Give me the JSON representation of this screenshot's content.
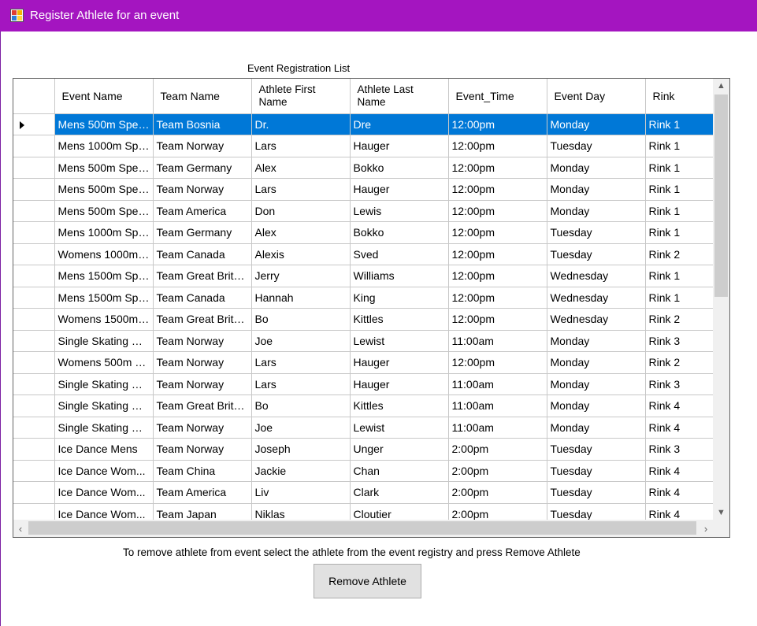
{
  "window": {
    "title": "Register Athlete for an event",
    "icon": "app-grid-icon"
  },
  "grid": {
    "caption": "Event Registration List",
    "columns": [
      "Event Name",
      "Team Name",
      "Athlete First Name",
      "Athlete Last Name",
      "Event_Time",
      "Event Day",
      "Rink"
    ],
    "selected_row": 0,
    "rows": [
      [
        "Mens 500m Spee...",
        "Team Bosnia",
        "Dr.",
        "Dre",
        "12:00pm",
        "Monday",
        "Rink 1"
      ],
      [
        "Mens 1000m Spe...",
        "Team Norway",
        "Lars",
        "Hauger",
        "12:00pm",
        "Tuesday",
        "Rink 1"
      ],
      [
        "Mens 500m Spee...",
        "Team Germany",
        "Alex",
        "Bokko",
        "12:00pm",
        "Monday",
        "Rink 1"
      ],
      [
        "Mens 500m Spee...",
        "Team Norway",
        "Lars",
        "Hauger",
        "12:00pm",
        "Monday",
        "Rink 1"
      ],
      [
        "Mens 500m Spee...",
        "Team America",
        "Don",
        "Lewis",
        "12:00pm",
        "Monday",
        "Rink 1"
      ],
      [
        "Mens 1000m Spe...",
        "Team Germany",
        "Alex",
        "Bokko",
        "12:00pm",
        "Tuesday",
        "Rink 1"
      ],
      [
        "Womens 1000m ...",
        "Team Canada",
        "Alexis",
        "Sved",
        "12:00pm",
        "Tuesday",
        "Rink 2"
      ],
      [
        "Mens 1500m Spe...",
        "Team Great Britain",
        "Jerry",
        "Williams",
        "12:00pm",
        "Wednesday",
        "Rink 1"
      ],
      [
        "Mens 1500m Spe...",
        "Team Canada",
        "Hannah",
        "King",
        "12:00pm",
        "Wednesday",
        "Rink 1"
      ],
      [
        "Womens 1500m ...",
        "Team Great Britain",
        "Bo",
        "Kittles",
        "12:00pm",
        "Wednesday",
        "Rink 2"
      ],
      [
        "Single Skating M...",
        "Team Norway",
        "Joe",
        "Lewist",
        "11:00am",
        "Monday",
        "Rink 3"
      ],
      [
        "Womens 500m S...",
        "Team Norway",
        "Lars",
        "Hauger",
        "12:00pm",
        "Monday",
        "Rink 2"
      ],
      [
        "Single Skating M...",
        "Team Norway",
        "Lars",
        "Hauger",
        "11:00am",
        "Monday",
        "Rink 3"
      ],
      [
        "Single Skating W...",
        "Team Great Britain",
        "Bo",
        "Kittles",
        "11:00am",
        "Monday",
        "Rink 4"
      ],
      [
        "Single Skating W...",
        "Team Norway",
        "Joe",
        "Lewist",
        "11:00am",
        "Monday",
        "Rink 4"
      ],
      [
        "Ice Dance Mens",
        "Team Norway",
        "Joseph",
        "Unger",
        "2:00pm",
        "Tuesday",
        "Rink 3"
      ],
      [
        "Ice Dance Wom...",
        "Team China",
        "Jackie",
        "Chan",
        "2:00pm",
        "Tuesday",
        "Rink 4"
      ],
      [
        "Ice Dance Wom...",
        "Team America",
        "Liv",
        "Clark",
        "2:00pm",
        "Tuesday",
        "Rink 4"
      ],
      [
        "Ice Dance Wom...",
        "Team Japan",
        "Niklas",
        "Cloutier",
        "2:00pm",
        "Tuesday",
        "Rink 4"
      ]
    ]
  },
  "hint": "To remove athlete from event select the athlete from the event registry and press Remove Athlete",
  "remove_button": "Remove Athlete",
  "colors": {
    "titlebar": "#a415c0",
    "selection": "#0078d7"
  }
}
